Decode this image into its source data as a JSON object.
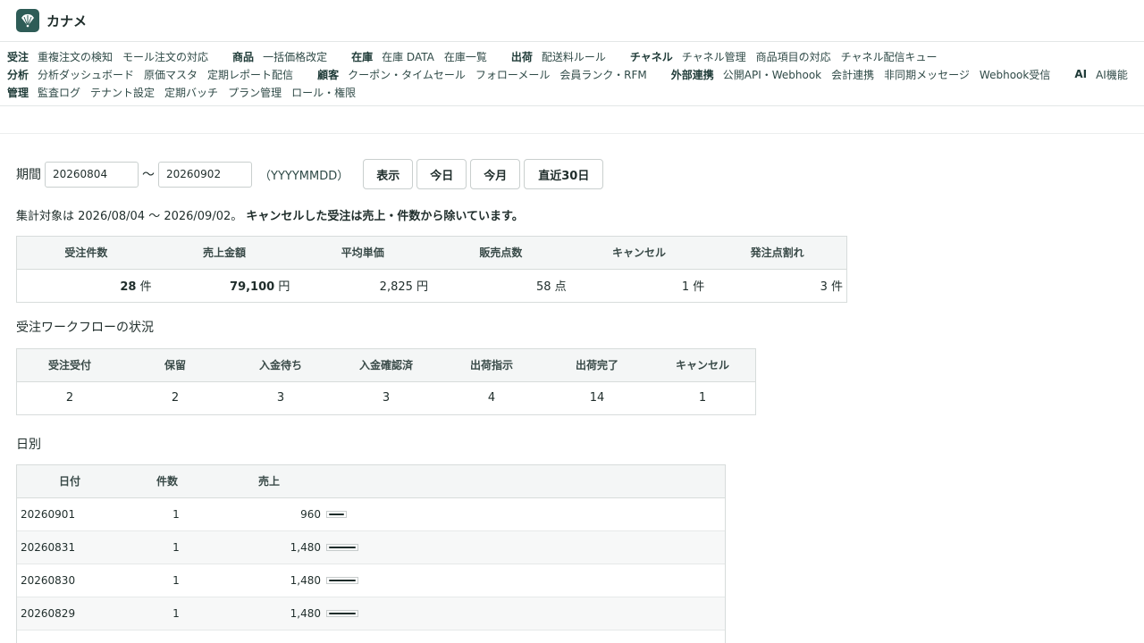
{
  "app": {
    "name": "カナメ",
    "logo": "fan-logo-icon"
  },
  "nav": {
    "rows": [
      [
        {
          "label": "受注",
          "links": [
            "重複注文の検知",
            "モール注文の対応"
          ]
        },
        {
          "label": "商品",
          "links": [
            "一括価格改定"
          ]
        },
        {
          "label": "在庫",
          "links": [
            "在庫 DATA",
            "在庫一覧"
          ]
        },
        {
          "label": "出荷",
          "links": [
            "配送料ルール"
          ]
        },
        {
          "label": "チャネル",
          "links": [
            "チャネル管理",
            "商品項目の対応",
            "チャネル配信キュー"
          ]
        }
      ],
      [
        {
          "label": "分析",
          "links": [
            "分析ダッシュボード",
            "原価マスタ",
            "定期レポート配信"
          ]
        },
        {
          "label": "顧客",
          "links": [
            "クーポン・タイムセール",
            "フォローメール",
            "会員ランク・RFM"
          ]
        },
        {
          "label": "外部連携",
          "links": [
            "公開API・Webhook",
            "会計連携",
            "非同期メッセージ",
            "Webhook受信"
          ]
        },
        {
          "label": "AI",
          "links": [
            "AI機能"
          ]
        }
      ],
      [
        {
          "label": "管理",
          "links": [
            "監査ログ",
            "テナント設定",
            "定期バッチ",
            "プラン管理",
            "ロール・権限"
          ]
        }
      ]
    ]
  },
  "filter": {
    "label": "期間",
    "from": "20260804",
    "to": "20260902",
    "tilde": "〜",
    "format_hint": "（YYYYMMDD）",
    "buttons": {
      "show": "表示",
      "today": "今日",
      "this_month": "今月",
      "last30": "直近30日"
    }
  },
  "summary_note": {
    "prefix": "集計対象は 2026/08/04 〜 2026/09/02。",
    "emphasis": "キャンセルした受注は売上・件数から除いています。"
  },
  "kpi": {
    "headers": [
      "受注件数",
      "売上金額",
      "平均単価",
      "販売点数",
      "キャンセル",
      "発注点割れ"
    ],
    "values": [
      {
        "num": "28",
        "unit": "件",
        "bold": true
      },
      {
        "num": "79,100",
        "unit": "円",
        "bold": true
      },
      {
        "num": "2,825",
        "unit": "円",
        "bold": false
      },
      {
        "num": "58",
        "unit": "点",
        "bold": false
      },
      {
        "num": "1",
        "unit": "件",
        "bold": false
      },
      {
        "num": "3",
        "unit": "件",
        "bold": false
      }
    ]
  },
  "workflow": {
    "title": "受注ワークフローの状況",
    "headers": [
      "受注受付",
      "保留",
      "入金待ち",
      "入金確認済",
      "出荷指示",
      "出荷完了",
      "キャンセル"
    ],
    "values": [
      "2",
      "2",
      "3",
      "3",
      "4",
      "14",
      "1"
    ]
  },
  "daily": {
    "title": "日別",
    "headers": {
      "date": "日付",
      "count": "件数",
      "sales": "売上"
    },
    "rows": [
      {
        "date": "20260901",
        "count": "1",
        "sales": "960",
        "ratio": 0.65
      },
      {
        "date": "20260831",
        "count": "1",
        "sales": "1,480",
        "ratio": 1.0
      },
      {
        "date": "20260830",
        "count": "1",
        "sales": "1,480",
        "ratio": 1.0
      },
      {
        "date": "20260829",
        "count": "1",
        "sales": "1,480",
        "ratio": 1.0
      }
    ]
  }
}
